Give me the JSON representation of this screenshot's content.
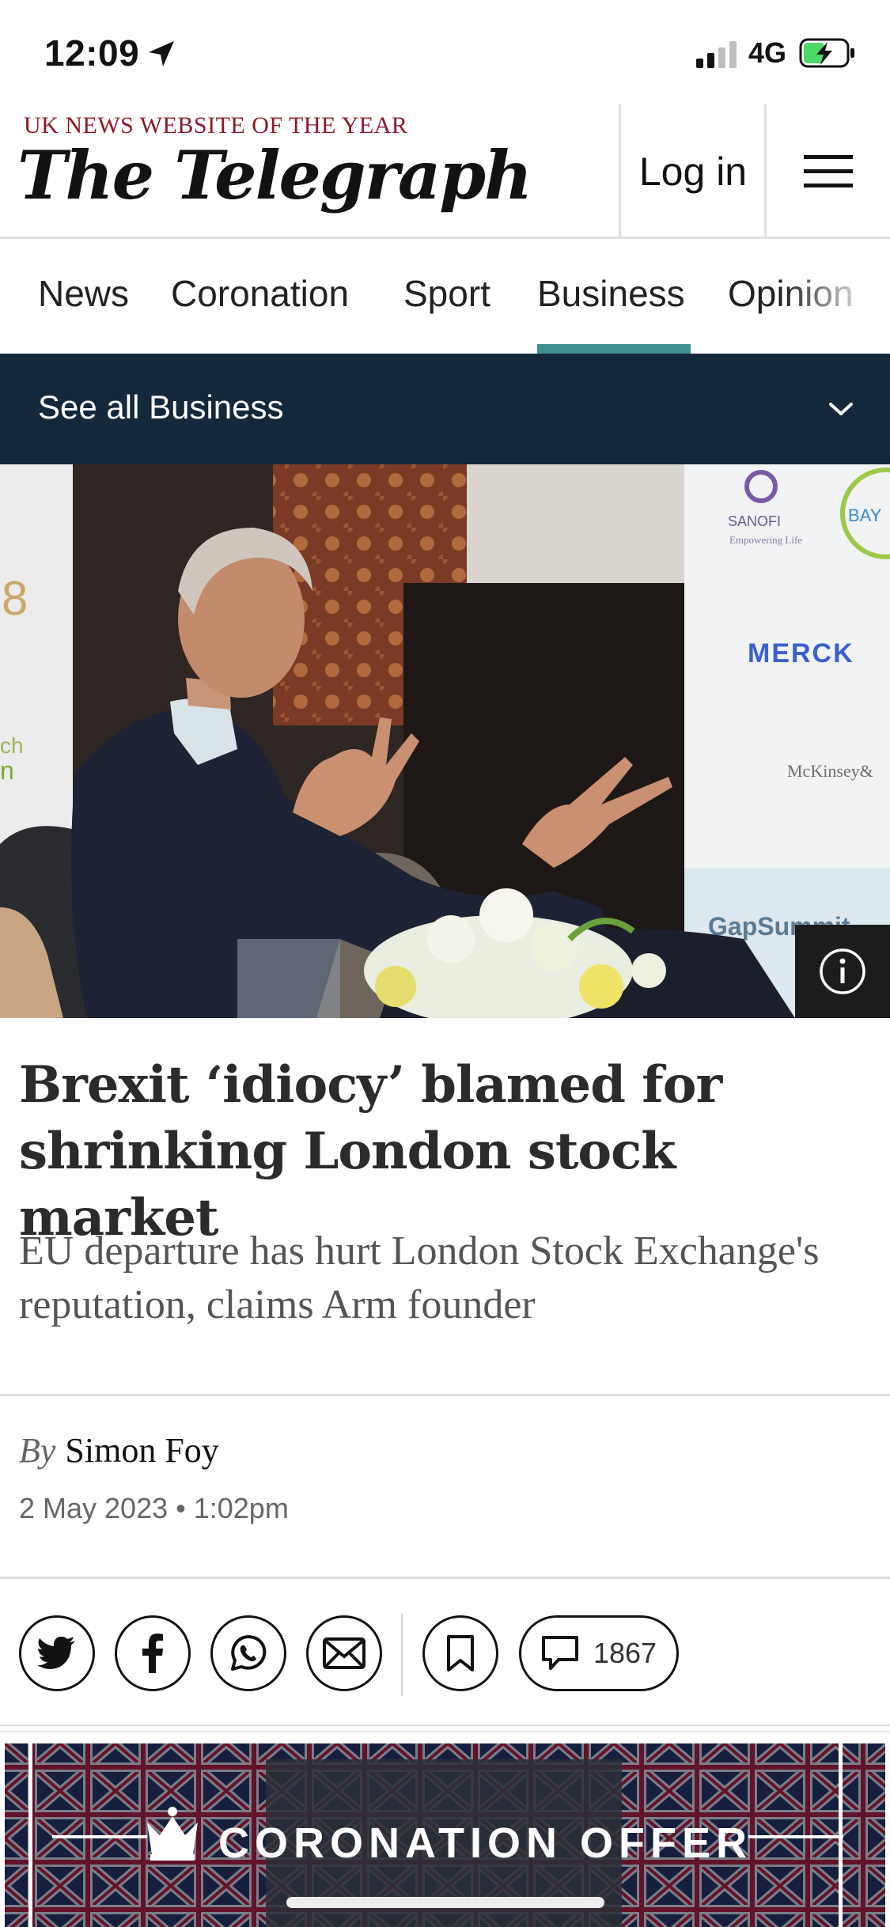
{
  "status_bar": {
    "time": "12:09",
    "network": "4G"
  },
  "masthead": {
    "tagline": "UK NEWS WEBSITE OF THE YEAR",
    "logo": "The Telegraph",
    "login_label": "Log in"
  },
  "nav": {
    "tabs": [
      "News",
      "Coronation",
      "Sport",
      "Business",
      "Opinion"
    ],
    "active": "Business"
  },
  "subnav": {
    "label": "See all Business"
  },
  "hero": {
    "sponsor_logos": [
      "SANOFI",
      "Empowering Life",
      "BAYER",
      "MERCK",
      "McKinsey&",
      "GapSummit"
    ]
  },
  "article": {
    "headline": "Brexit ‘idiocy’ blamed for shrinking London stock market",
    "standfirst": "EU departure has hurt London Stock Exchange's reputation, claims Arm founder",
    "byline_prefix": "By",
    "author": "Simon Foy",
    "date": "2 May 2023 • 1:02pm"
  },
  "share": {
    "comments_count": "1867"
  },
  "promo": {
    "text": "CORONATION OFFER"
  },
  "colors": {
    "accent": "#3f8f8f",
    "subnav_bg": "#13283b",
    "tagline": "#8b1a2a"
  }
}
